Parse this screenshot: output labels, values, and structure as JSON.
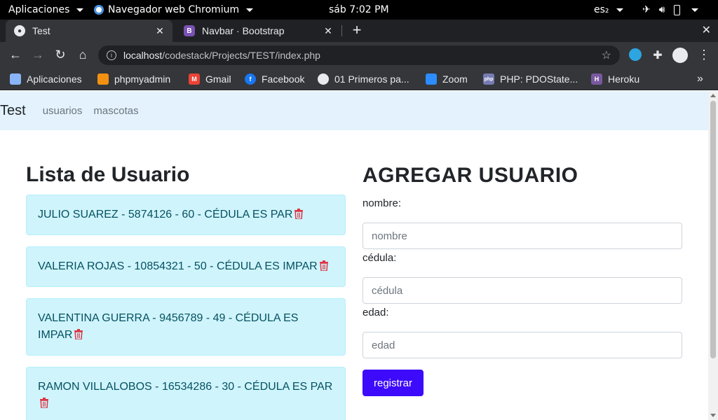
{
  "gnome": {
    "apps_menu": "Aplicaciones",
    "app_menu": "Navegador web Chromium",
    "clock": "sáb  7:02 PM",
    "keyboard": "es₂"
  },
  "tabs": [
    {
      "title": "Test",
      "active": true
    },
    {
      "title": "Navbar · Bootstrap",
      "active": false,
      "favicon": "B"
    }
  ],
  "omnibox": {
    "host": "localhost",
    "path": "/codestack/Projects/TEST/index.php"
  },
  "bookmarks": [
    {
      "label": "Aplicaciones",
      "icon": "apps-grid-icon"
    },
    {
      "label": "phpmyadmin",
      "icon": "phpmyadmin-icon"
    },
    {
      "label": "Gmail",
      "icon": "gmail-icon"
    },
    {
      "label": "Facebook",
      "icon": "facebook-icon"
    },
    {
      "label": "01 Primeros pa...",
      "icon": "globe-icon"
    },
    {
      "label": "Zoom",
      "icon": "zoom-icon"
    },
    {
      "label": "PHP: PDOState...",
      "icon": "php-icon"
    },
    {
      "label": "Heroku",
      "icon": "heroku-icon"
    }
  ],
  "navbar": {
    "brand": "Test",
    "links": [
      "usuarios",
      "mascotas"
    ]
  },
  "user_list": {
    "title": "Lista de Usuario",
    "items": [
      "JULIO SUAREZ - 5874126 - 60 - CÉDULA ES PAR",
      "VALERIA ROJAS - 10854321 - 50 - CÉDULA ES IMPAR",
      "VALENTINA GUERRA - 9456789 - 49 - CÉDULA ES IMPAR",
      "RAMON VILLALOBOS - 16534286 - 30 - CÉDULA ES PAR"
    ]
  },
  "form": {
    "title": "AGREGAR USUARIO",
    "name_label": "nombre:",
    "name_placeholder": "nombre",
    "id_label": "cédula:",
    "id_placeholder": "cédula",
    "age_label": "edad:",
    "age_placeholder": "edad",
    "submit": "registrar"
  },
  "colors": {
    "navbar_bg": "#e3f2fd",
    "card_bg": "#cff4fc",
    "card_text": "#055160",
    "trash": "#dc3545",
    "submit_bg": "#3d0afc"
  }
}
